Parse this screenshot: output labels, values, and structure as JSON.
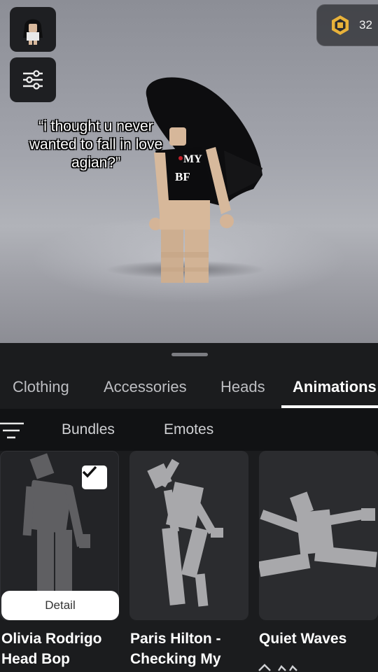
{
  "viewport": {
    "caption": "“i thought u never wanted to fall in love agian?”",
    "shirt_text_line1": "MY",
    "shirt_text_line2": "BF",
    "currency": {
      "icon": "robux-icon",
      "amount": "32"
    },
    "icons": {
      "avatar_thumb": "avatar-thumbnail",
      "filter": "sliders-icon"
    }
  },
  "tabs": [
    {
      "label": "Clothing",
      "active": false
    },
    {
      "label": "Accessories",
      "active": false
    },
    {
      "label": "Heads",
      "active": false
    },
    {
      "label": "Animations",
      "active": true
    }
  ],
  "subtabs": {
    "sort_icon": "sort-lines-icon",
    "items": [
      "Bundles",
      "Emotes"
    ]
  },
  "items": [
    {
      "title_line1": "Olivia Rodrigo",
      "title_line2": "Head Bop",
      "selected": true,
      "detail_label": "Detail"
    },
    {
      "title_line1": "Paris Hilton -",
      "title_line2": "Checking My",
      "selected": false
    },
    {
      "title_line1": "Quiet Waves",
      "title_line2": "",
      "selected": false
    }
  ],
  "colors": {
    "panel_bg": "#1b1c1e",
    "subbar_bg": "#111214",
    "card_bg": "#2b2c2f",
    "accent": "#ffffff",
    "robux_gold": "#e8b23a"
  }
}
